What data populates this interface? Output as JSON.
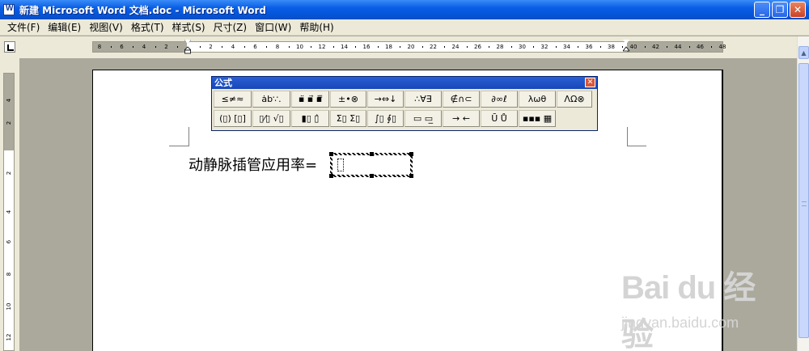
{
  "window": {
    "title": "新建 Microsoft Word 文档.doc - Microsoft Word",
    "controls": {
      "minimize": "_",
      "restore": "❐",
      "close": "✕"
    }
  },
  "menubar": {
    "items": [
      "文件(F)",
      "编辑(E)",
      "视图(V)",
      "格式(T)",
      "样式(S)",
      "尺寸(Z)",
      "窗口(W)",
      "帮助(H)"
    ]
  },
  "ruler": {
    "horizontal_ticks": [
      "8",
      "6",
      "4",
      "2",
      "",
      "2",
      "4",
      "6",
      "8",
      "10",
      "12",
      "14",
      "16",
      "18",
      "20",
      "22",
      "24",
      "26",
      "28",
      "30",
      "32",
      "34",
      "36",
      "38",
      "40",
      "42",
      "44",
      "46",
      "48"
    ],
    "vertical_ticks": [
      "4",
      "2",
      "2",
      "4",
      "6",
      "8",
      "10",
      "12"
    ]
  },
  "document": {
    "text": "动静脉插管应用率="
  },
  "palette": {
    "title": "公式",
    "close": "✕",
    "row1": [
      "≤≠≈",
      "ȧb∵.",
      "▪̈ ▪⃗ ▪̿",
      "±•⊗",
      "→⇔↓",
      "∴∀∃",
      "∉∩⊂",
      "∂∞ℓ",
      "λωθ",
      "ΛΩ⊗"
    ],
    "row2": [
      "(▯) [▯]",
      "▯⁄▯ √▯",
      "▮▯ ▯̂",
      "Σ▯ Σ▯",
      "∫▯ ∮▯",
      "▭ ▭̲",
      "→ ←",
      "Ū Ů",
      "▪▪▪ ▦"
    ]
  },
  "scrollbar": {
    "up": "▲",
    "down": "▼"
  },
  "watermark": {
    "main": "Bai du 经验",
    "sub": "jingyan.baidu.com"
  }
}
